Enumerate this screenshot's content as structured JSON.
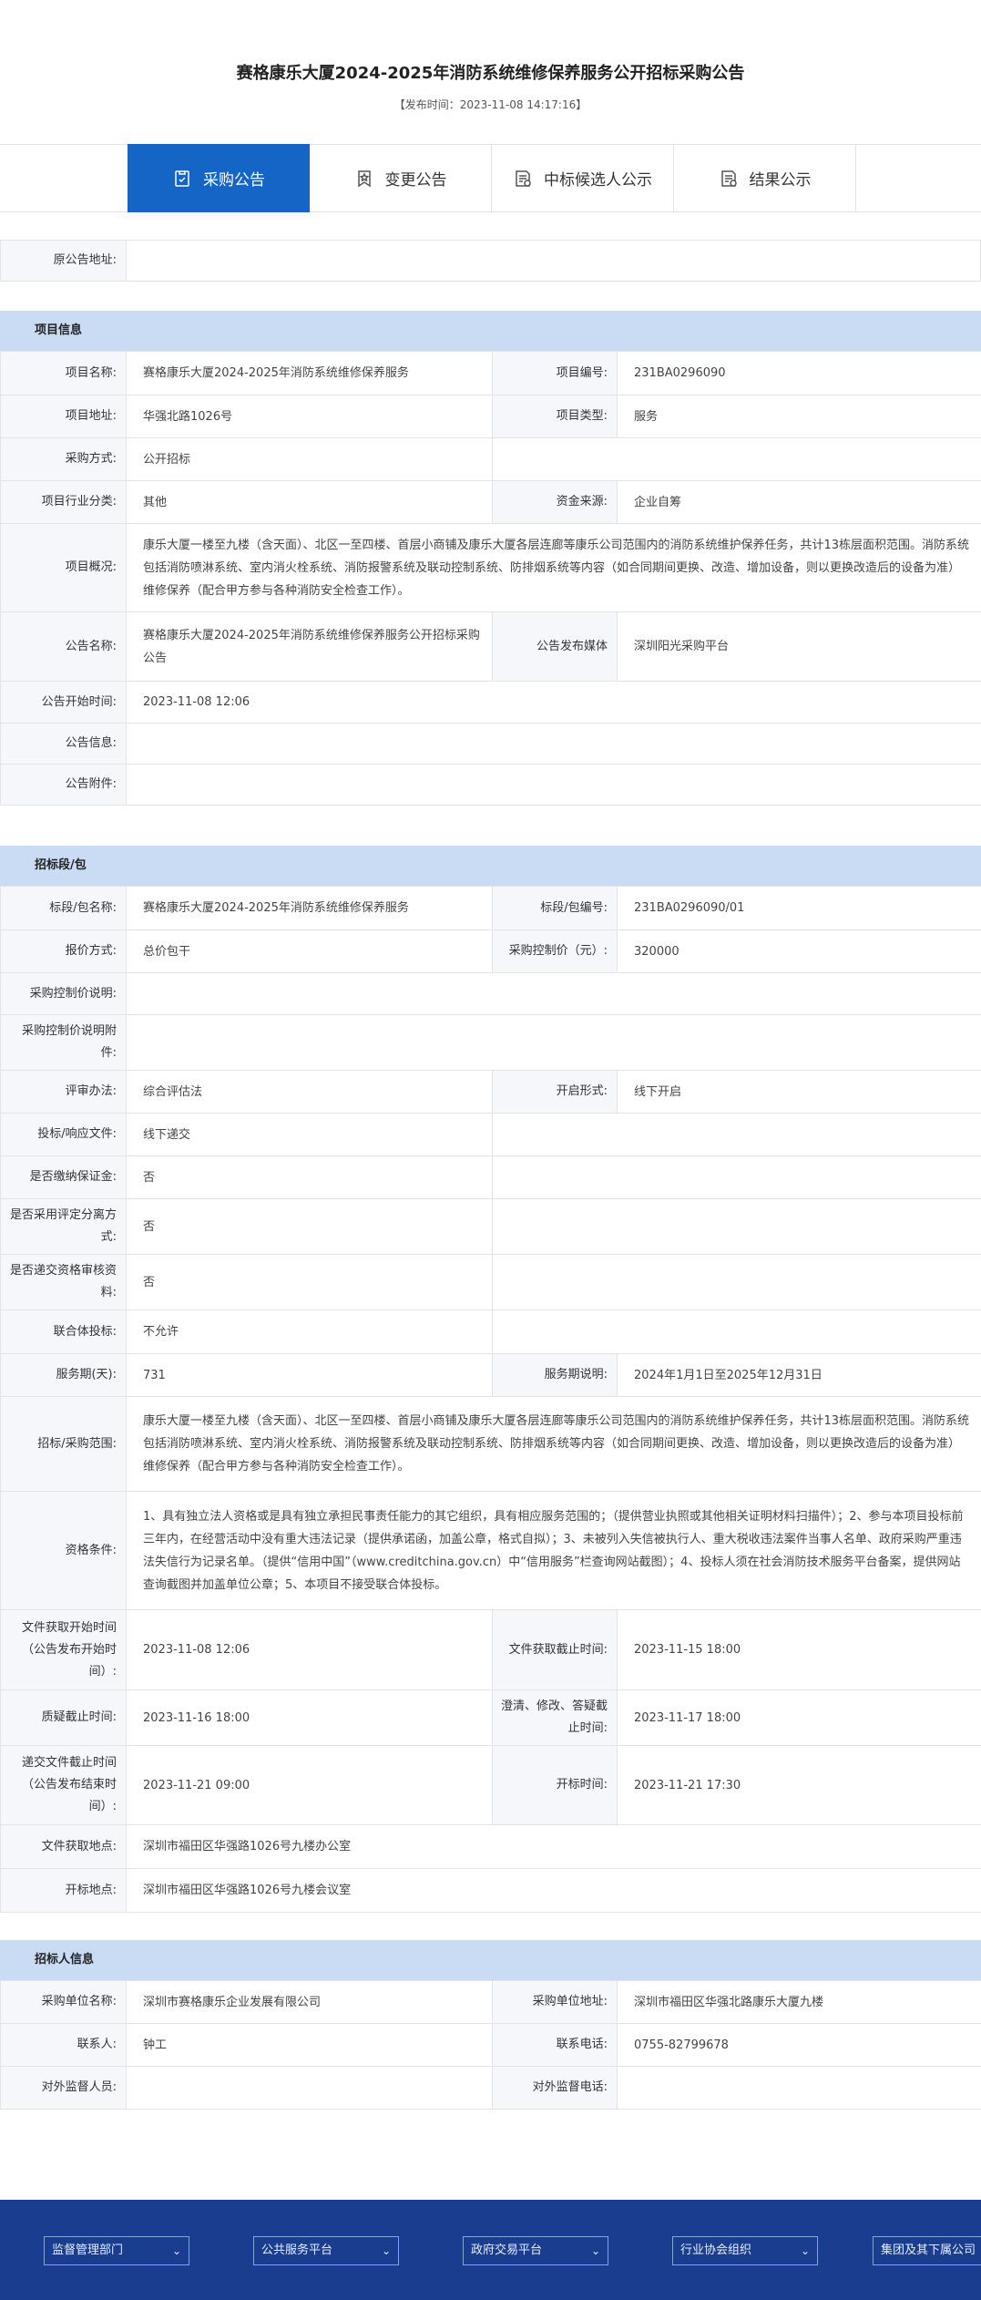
{
  "page": {
    "title": "赛格康乐大厦2024-2025年消防系统维修保养服务公开招标采购公告",
    "publish_time": "【发布时间：2023-11-08 14:17:16】"
  },
  "tabs": [
    {
      "label": "采购公告",
      "icon": "document-check-icon"
    },
    {
      "label": "变更公告",
      "icon": "bookmark-star-icon"
    },
    {
      "label": "中标候选人公示",
      "icon": "document-stamp-icon"
    },
    {
      "label": "结果公示",
      "icon": "document-stamp-icon"
    }
  ],
  "original": {
    "label": "原公告地址:",
    "value": ""
  },
  "project": {
    "heading": "项目信息",
    "name_label": "项目名称:",
    "name": "赛格康乐大厦2024-2025年消防系统维修保养服务",
    "code_label": "项目编号:",
    "code": "231BA0296090",
    "address_label": "项目地址:",
    "address": "华强北路1026号",
    "type_label": "项目类型:",
    "type": "服务",
    "method_label": "采购方式:",
    "method": "公开招标",
    "industry_label": "项目行业分类:",
    "industry": "其他",
    "fund_label": "资金来源:",
    "fund": "企业自筹",
    "overview_label": "项目概况:",
    "overview": "康乐大厦一楼至九楼（含天面）、北区一至四楼、首层小商铺及康乐大厦各层连廊等康乐公司范围内的消防系统维护保养任务，共计13栋层面积范围。消防系统包括消防喷淋系统、室内消火栓系统、消防报警系统及联动控制系统、防排烟系统等内容（如合同期间更换、改造、增加设备，则以更换改造后的设备为准）维修保养（配合甲方参与各种消防安全检查工作）。",
    "notice_name_label": "公告名称:",
    "notice_name": "赛格康乐大厦2024-2025年消防系统维修保养服务公开招标采购公告",
    "media_label": "公告发布媒体",
    "media": "深圳阳光采购平台",
    "start_label": "公告开始时间:",
    "start": "2023-11-08 12:06",
    "info_label": "公告信息:",
    "info": "",
    "attach_label": "公告附件:",
    "attach": ""
  },
  "lot": {
    "heading": "招标段/包",
    "name_label": "标段/包名称:",
    "name": "赛格康乐大厦2024-2025年消防系统维修保养服务",
    "code_label": "标段/包编号:",
    "code": "231BA0296090/01",
    "quote_label": "报价方式:",
    "quote": "总价包干",
    "ceiling_label": "采购控制价（元）:",
    "ceiling": "320000",
    "ceiling_desc_label": "采购控制价说明:",
    "ceiling_desc": "",
    "ceiling_attach_label": "采购控制价说明附件:",
    "ceiling_attach": "",
    "eval_label": "评审办法:",
    "eval": "综合评估法",
    "open_form_label": "开启形式:",
    "open_form": "线下开启",
    "submit_label": "投标/响应文件:",
    "submit": "线下递交",
    "deposit_label": "是否缴纳保证金:",
    "deposit": "否",
    "separate_label": "是否采用评定分离方式:",
    "separate": "否",
    "qual_review_label": "是否递交资格审核资料:",
    "qual_review": "否",
    "consortium_label": "联合体投标:",
    "consortium": "不允许",
    "period_label": "服务期(天):",
    "period": "731",
    "period_desc_label": "服务期说明:",
    "period_desc": "2024年1月1日至2025年12月31日",
    "scope_label": "招标/采购范围:",
    "scope": "康乐大厦一楼至九楼（含天面）、北区一至四楼、首层小商铺及康乐大厦各层连廊等康乐公司范围内的消防系统维护保养任务，共计13栋层面积范围。消防系统包括消防喷淋系统、室内消火栓系统、消防报警系统及联动控制系统、防排烟系统等内容（如合同期间更换、改造、增加设备，则以更换改造后的设备为准）维修保养（配合甲方参与各种消防安全检查工作）。",
    "qualify_label": "资格条件:",
    "qualify": "1、具有独立法人资格或是具有独立承担民事责任能力的其它组织，具有相应服务范围的；（提供营业执照或其他相关证明材料扫描件）；2、参与本项目投标前三年内，在经营活动中没有重大违法记录（提供承诺函，加盖公章，格式自拟）；3、未被列入失信被执行人、重大税收违法案件当事人名单、政府采购严重违法失信行为记录名单。（提供“信用中国”（www.creditchina.gov.cn）中“信用服务”栏查询网站截图）；4、投标人须在社会消防技术服务平台备案，提供网站查询截图并加盖单位公章；5、本项目不接受联合体投标。",
    "doc_start_label": "文件获取开始时间（公告发布开始时间）:",
    "doc_start": "2023-11-08 12:06",
    "doc_end_label": "文件获取截止时间:",
    "doc_end": "2023-11-15 18:00",
    "question_label": "质疑截止时间:",
    "question": "2023-11-16 18:00",
    "clarify_label": "澄清、修改、答疑截止时间:",
    "clarify": "2023-11-17 18:00",
    "deadline_label": "递交文件截止时间（公告发布结束时间）:",
    "deadline": "2023-11-21 09:00",
    "open_time_label": "开标时间:",
    "open_time": "2023-11-21 17:30",
    "doc_place_label": "文件获取地点:",
    "doc_place": "深圳市福田区华强路1026号九楼办公室",
    "open_place_label": "开标地点:",
    "open_place": "深圳市福田区华强路1026号九楼会议室"
  },
  "tenderer": {
    "heading": "招标人信息",
    "unit_label": "采购单位名称:",
    "unit": "深圳市赛格康乐企业发展有限公司",
    "unit_addr_label": "采购单位地址:",
    "unit_addr": "深圳市福田区华强北路康乐大厦九楼",
    "contact_label": "联系人:",
    "contact": "钟工",
    "phone_label": "联系电话:",
    "phone": "0755-82799678",
    "supervisor_label": "对外监督人员:",
    "supervisor": "",
    "sup_phone_label": "对外监督电话:",
    "sup_phone": ""
  },
  "footer": {
    "selects": [
      "监督管理部门",
      "公共服务平台",
      "政府交易平台",
      "行业协会组织",
      "集团及其下属公司"
    ]
  },
  "colors": {
    "accent": "#1565c6",
    "section": "#c9dcf3",
    "footer": "#1a3d8f"
  }
}
